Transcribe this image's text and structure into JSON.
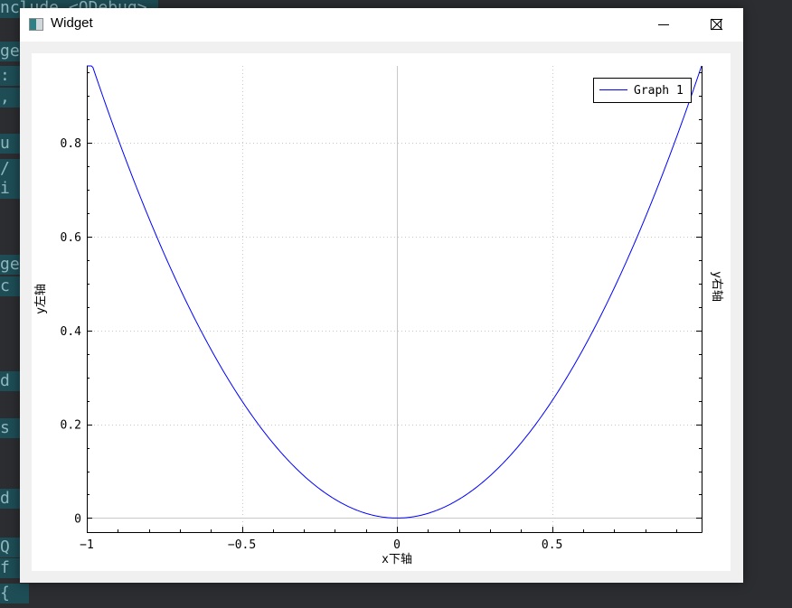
{
  "background_editor": {
    "lines": [
      {
        "text": "nclude <QDebug>",
        "top": 0
      },
      {
        "text": "ge",
        "top": 48
      },
      {
        "text": " :",
        "top": 75
      },
      {
        "text": " ,",
        "top": 99
      },
      {
        "text": " u",
        "top": 150
      },
      {
        "text": " /",
        "top": 178
      },
      {
        "text": " i",
        "top": 200
      },
      {
        "text": "ge",
        "top": 284
      },
      {
        "text": " c",
        "top": 308
      },
      {
        "text": "d",
        "top": 413
      },
      {
        "text": " s",
        "top": 465
      },
      {
        "text": "d",
        "top": 543
      },
      {
        "text": " Q",
        "top": 597
      },
      {
        "text": " f",
        "top": 620
      },
      {
        "text": " {",
        "top": 648
      }
    ]
  },
  "window": {
    "title": "Widget",
    "icon": "qt-window-icon",
    "controls": {
      "minimize": "minimize-icon",
      "maximize": "maximize-icon",
      "close": "close-icon"
    }
  },
  "colors": {
    "series": "#0000ff",
    "axis": "#000000",
    "grid": "#c8c8c8",
    "zero_line": "#c8c8c8"
  },
  "chart_data": {
    "type": "line",
    "title": "",
    "xlabel": "x下轴",
    "ylabel": "y左轴",
    "y2label": "y右轴",
    "xlim": [
      -1,
      0.982
    ],
    "ylim": [
      -0.03,
      0.964
    ],
    "x_ticks": [
      -1,
      -0.5,
      0,
      0.5
    ],
    "x_tick_labels": [
      "−1",
      "−0.5",
      "0",
      "0.5"
    ],
    "y_ticks": [
      0,
      0.2,
      0.4,
      0.6,
      0.8
    ],
    "y_tick_labels": [
      "0",
      "0.2",
      "0.4",
      "0.6",
      "0.8"
    ],
    "grid": true,
    "legend": {
      "position": "top-right",
      "entries": [
        "Graph 1"
      ]
    },
    "series": [
      {
        "name": "Graph 1",
        "function": "y = x^2",
        "x": [
          -1,
          -0.9,
          -0.8,
          -0.7,
          -0.6,
          -0.5,
          -0.4,
          -0.3,
          -0.2,
          -0.1,
          0,
          0.1,
          0.2,
          0.3,
          0.4,
          0.5,
          0.6,
          0.7,
          0.8,
          0.9,
          0.98
        ],
        "y": [
          1,
          0.81,
          0.64,
          0.49,
          0.36,
          0.25,
          0.16,
          0.09,
          0.04,
          0.01,
          0,
          0.01,
          0.04,
          0.09,
          0.16,
          0.25,
          0.36,
          0.49,
          0.64,
          0.81,
          0.9604
        ]
      }
    ]
  }
}
